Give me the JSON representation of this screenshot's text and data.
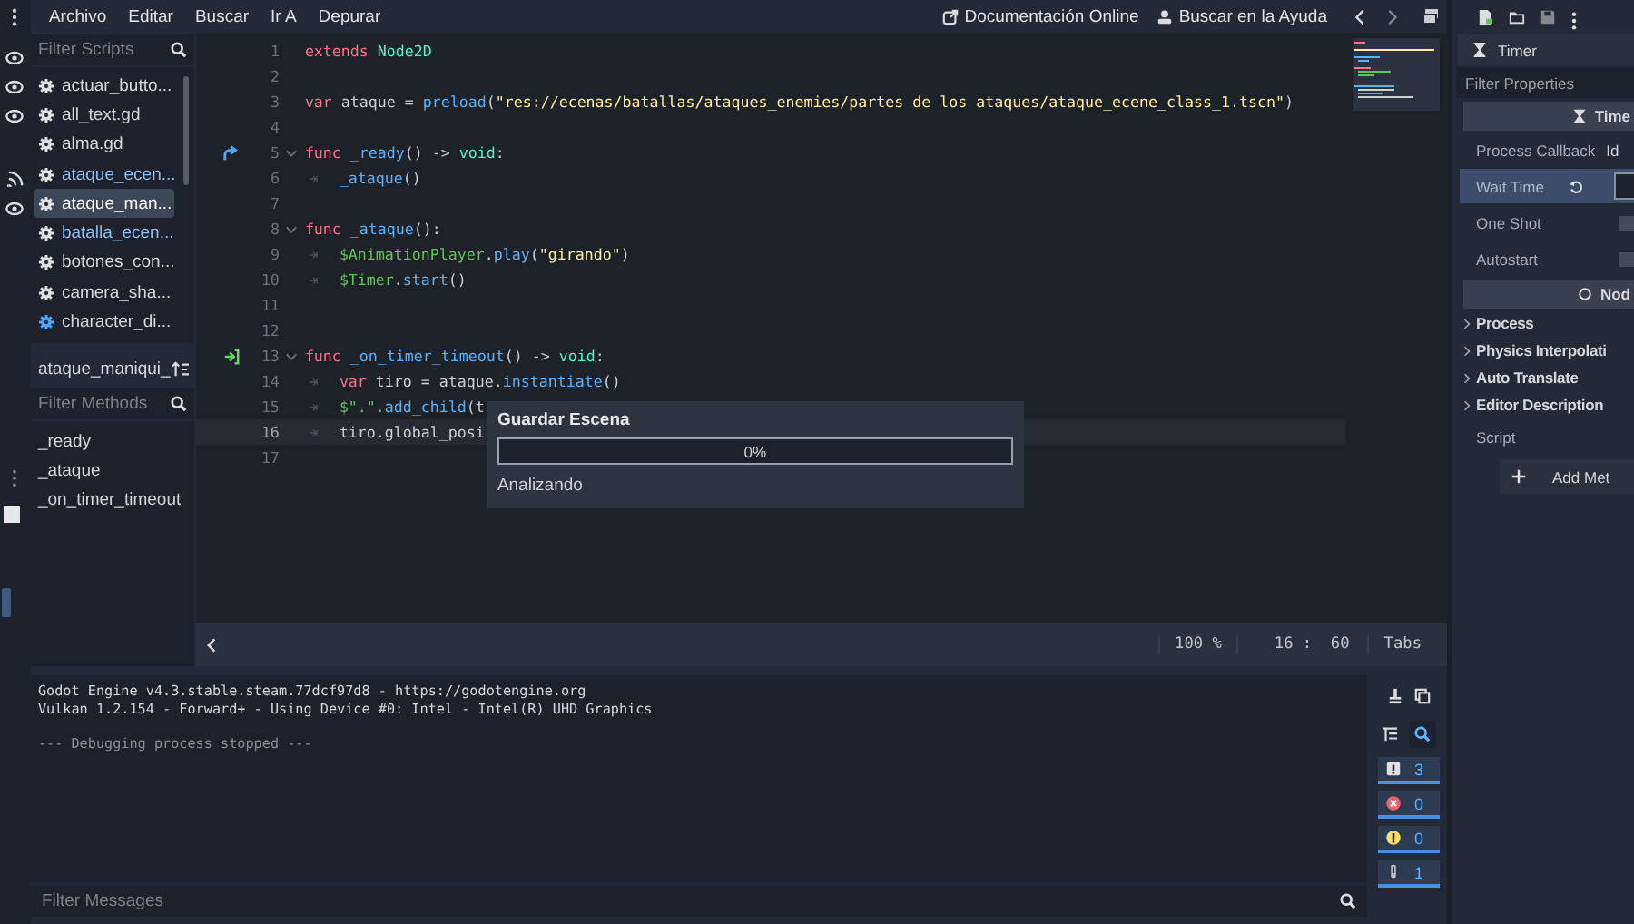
{
  "menu": [
    "Archivo",
    "Editar",
    "Buscar",
    "Ir A",
    "Depurar"
  ],
  "help_links": [
    {
      "kind": "docs",
      "label": "Documentación Online"
    },
    {
      "kind": "help",
      "label": "Buscar en la Ayuda"
    }
  ],
  "scripts": {
    "placeholder": "Filter Scripts",
    "items": [
      {
        "name": "actuar_butto...",
        "selected": false,
        "color": "#d4d7dc",
        "tool": false
      },
      {
        "name": "all_text.gd",
        "selected": false,
        "color": "#d4d7dc",
        "tool": false
      },
      {
        "name": "alma.gd",
        "selected": false,
        "color": "#d4d7dc",
        "tool": false
      },
      {
        "name": "ataque_ecen...",
        "selected": false,
        "color": "#8fbff0",
        "tool": false
      },
      {
        "name": "ataque_man...",
        "selected": true,
        "color": "#ffffff",
        "tool": false
      },
      {
        "name": "batalla_ecen...",
        "selected": false,
        "color": "#8fbff0",
        "tool": false
      },
      {
        "name": "botones_con...",
        "selected": false,
        "color": "#d4d7dc",
        "tool": false
      },
      {
        "name": "camera_sha...",
        "selected": false,
        "color": "#d4d7dc",
        "tool": false
      },
      {
        "name": "character_di...",
        "selected": false,
        "color": "#d4d7dc",
        "tool": true
      }
    ]
  },
  "methods": {
    "title": "ataque_maniqui_",
    "placeholder": "Filter Methods",
    "items": [
      "_ready",
      "_ataque",
      "_on_timer_timeout"
    ]
  },
  "code": [
    {
      "n": "1",
      "tokens": [
        {
          "kind": "keyword",
          "text": "extends "
        },
        {
          "kind": "type",
          "text": "Node2D"
        }
      ]
    },
    {
      "n": "2"
    },
    {
      "n": "3",
      "tokens": [
        {
          "kind": "keyword",
          "text": "var"
        },
        {
          "kind": "plain",
          "text": " ataque = "
        },
        {
          "kind": "func",
          "text": "preload"
        },
        {
          "kind": "plain",
          "text": "("
        },
        {
          "kind": "string",
          "text": "\"res://ecenas/batallas/ataques_enemies/partes de los ataques/ataque_ecene_class_1.tscn\""
        },
        {
          "kind": "plain",
          "text": ")"
        }
      ]
    },
    {
      "n": "4"
    },
    {
      "n": "5",
      "marker": {
        "kind": "outgoing"
      },
      "foldable": true,
      "tokens": [
        {
          "kind": "keyword",
          "text": "func "
        },
        {
          "kind": "func",
          "text": "_ready"
        },
        {
          "kind": "plain",
          "text": "() -> "
        },
        {
          "kind": "type",
          "text": "void"
        },
        {
          "kind": "plain",
          "text": ":"
        }
      ]
    },
    {
      "n": "6",
      "indented": true,
      "tokens": [
        {
          "kind": "func",
          "text": "_ataque"
        },
        {
          "kind": "plain",
          "text": "()"
        }
      ]
    },
    {
      "n": "7"
    },
    {
      "n": "8",
      "foldable": true,
      "tokens": [
        {
          "kind": "keyword",
          "text": "func "
        },
        {
          "kind": "func",
          "text": "_ataque"
        },
        {
          "kind": "plain",
          "text": "():"
        }
      ]
    },
    {
      "n": "9",
      "indented": true,
      "tokens": [
        {
          "kind": "node",
          "text": "$AnimationPlayer"
        },
        {
          "kind": "plain",
          "text": "."
        },
        {
          "kind": "func",
          "text": "play"
        },
        {
          "kind": "plain",
          "text": "("
        },
        {
          "kind": "string",
          "text": "\"girando\""
        },
        {
          "kind": "plain",
          "text": ")"
        }
      ]
    },
    {
      "n": "10",
      "indented": true,
      "tokens": [
        {
          "kind": "node",
          "text": "$Timer"
        },
        {
          "kind": "plain",
          "text": "."
        },
        {
          "kind": "func",
          "text": "start"
        },
        {
          "kind": "plain",
          "text": "()"
        }
      ]
    },
    {
      "n": "11"
    },
    {
      "n": "12"
    },
    {
      "n": "13",
      "marker": {
        "kind": "incoming"
      },
      "foldable": true,
      "tokens": [
        {
          "kind": "keyword",
          "text": "func "
        },
        {
          "kind": "func",
          "text": "_on_timer_timeout"
        },
        {
          "kind": "plain",
          "text": "() -> "
        },
        {
          "kind": "type",
          "text": "void"
        },
        {
          "kind": "plain",
          "text": ":"
        }
      ]
    },
    {
      "n": "14",
      "indented": true,
      "tokens": [
        {
          "kind": "keyword",
          "text": "var"
        },
        {
          "kind": "plain",
          "text": " tiro = ataque."
        },
        {
          "kind": "func",
          "text": "instantiate"
        },
        {
          "kind": "plain",
          "text": "()"
        }
      ]
    },
    {
      "n": "15",
      "indented": true,
      "tokens": [
        {
          "kind": "node",
          "text": "$\".\"."
        },
        {
          "kind": "func",
          "text": "add_child"
        },
        {
          "kind": "plain",
          "text": "(t"
        }
      ]
    },
    {
      "n": "16",
      "indented": true,
      "current": true,
      "tokens": [
        {
          "kind": "plain",
          "text": "tiro.global_posi"
        }
      ]
    },
    {
      "n": "17"
    }
  ],
  "dialog": {
    "title": "Guardar Escena",
    "level": 0,
    "reading": "0%",
    "status": "Analizando"
  },
  "status_bar": {
    "zoom": "100 %",
    "position": "16 :  60",
    "indent": "Tabs"
  },
  "output": {
    "lines": [
      {
        "kind": "info",
        "text": "Godot Engine v4.3.stable.steam.77dcf97d8 - https://godotengine.org"
      },
      {
        "kind": "info",
        "text": "Vulkan 1.2.154 - Forward+ - Using Device #0: Intel - Intel(R) UHD Graphics"
      },
      {
        "kind": "dim",
        "text": "--- Debugging process stopped ---"
      }
    ],
    "placeholder": "Filter Messages",
    "counters": [
      {
        "kind": "message",
        "count": "3",
        "on": true
      },
      {
        "kind": "error",
        "count": "0",
        "on": true
      },
      {
        "kind": "warning",
        "count": "0",
        "on": true
      },
      {
        "kind": "editor",
        "count": "1",
        "on": true
      }
    ]
  },
  "inspector": {
    "node": "Timer",
    "placeholder": "Filter Properties",
    "rows": [
      {
        "kind": "section",
        "label": "Time"
      },
      {
        "kind": "property",
        "label": "Process Callback",
        "value": "Id",
        "selected": false
      },
      {
        "kind": "property",
        "label": "Wait Time",
        "selected": true,
        "revert": true
      },
      {
        "kind": "checkbox",
        "label": "One Shot",
        "checked": false
      },
      {
        "kind": "checkbox",
        "label": "Autostart",
        "checked": false
      },
      {
        "kind": "section",
        "label": "Nod"
      },
      {
        "kind": "group",
        "label": "Process"
      },
      {
        "kind": "group",
        "label": "Physics Interpolati"
      },
      {
        "kind": "group",
        "label": "Auto Translate"
      },
      {
        "kind": "group",
        "label": "Editor Description"
      },
      {
        "kind": "property",
        "label": "Script",
        "selected": false
      },
      {
        "kind": "button",
        "label": "Add Met"
      }
    ]
  }
}
